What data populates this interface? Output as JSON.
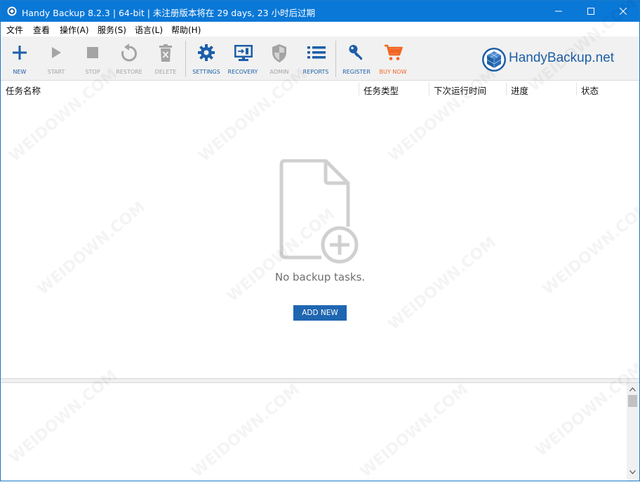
{
  "window": {
    "title": "Handy Backup 8.2.3 | 64-bit | 未注册版本将在 29 days, 23 小时后过期"
  },
  "menu": [
    {
      "label": "文件"
    },
    {
      "label": "查看"
    },
    {
      "label": "操作(A)"
    },
    {
      "label": "服务(S)"
    },
    {
      "label": "语言(L)"
    },
    {
      "label": "帮助(H)"
    }
  ],
  "toolbar": {
    "new": "NEW",
    "start": "START",
    "stop": "STOP",
    "restore": "RESTORE",
    "delete": "DELETE",
    "settings": "SETTINGS",
    "recovery": "RECOVERY",
    "admin": "ADMIN",
    "reports": "REPORTS",
    "register": "REGISTER",
    "buy_now": "BUY NOW"
  },
  "brand": {
    "name": "HandyBackup.net"
  },
  "columns": [
    {
      "label": "任务名称"
    },
    {
      "label": "任务类型"
    },
    {
      "label": "下次运行时间"
    },
    {
      "label": "进度"
    },
    {
      "label": "状态"
    }
  ],
  "empty_state": {
    "message": "No backup tasks.",
    "button": "ADD NEW"
  },
  "colors": {
    "titlebar": "#0a78d7",
    "accent_blue": "#1c5ea8",
    "disabled_gray": "#a4a4a4",
    "buy_orange": "#f26522",
    "button_blue": "#1f66b1"
  },
  "watermark": "WEIDOWN.COM"
}
